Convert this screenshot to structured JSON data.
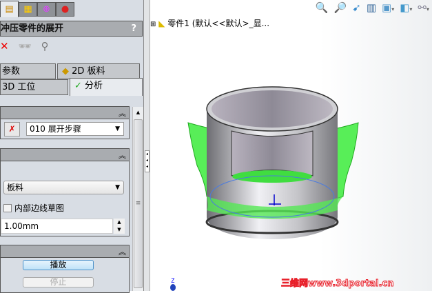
{
  "panel": {
    "title": "冲压零件的展开",
    "help": "?",
    "icons": [
      "property-manager-icon",
      "feature-tree-icon",
      "dimxpert-icon",
      "display-manager-icon"
    ],
    "tabs": [
      {
        "label": "参数"
      },
      {
        "label": "2D 板料"
      },
      {
        "label": "3D 工位"
      },
      {
        "label": "分析",
        "active": true
      }
    ],
    "group1": {
      "step_value": "010 展开步骤"
    },
    "group2": {
      "select_value": "板料",
      "checkbox_label": "内部边线草图",
      "checked": false,
      "thickness_value": "1.00mm"
    },
    "group3": {
      "play_label": "播放",
      "stop_label": "停止"
    }
  },
  "viewport": {
    "tree_label": "零件1  (默认<<默认>_显...",
    "toolbar": [
      "zoom-to-fit-icon",
      "zoom-area-icon",
      "previous-view-icon",
      "section-view-icon",
      "view-orientation-icon",
      "display-style-icon",
      "hide-show-icon"
    ],
    "axis_label": "Z",
    "watermark": "三维网www.3dportal.cn",
    "colors": {
      "green": "#44e844",
      "grey": "#a8a8b0",
      "accent": "#4a90c8"
    }
  }
}
